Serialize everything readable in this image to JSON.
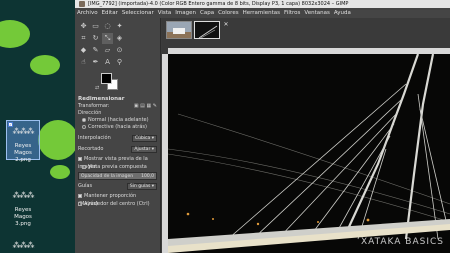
{
  "desktop": {
    "icons": [
      {
        "label": "Reyes Magos\n2.png",
        "selected": true
      },
      {
        "label": "Reyes Magos\n3.png",
        "selected": false
      },
      {
        "label": "",
        "selected": false
      }
    ],
    "thumb_text": "⁂⁂⁂",
    "accent_color": "#7fd93a"
  },
  "window": {
    "title": "[IMG_7792] (importada)-4.0 (Color RGB Entero gamma de 8 bits, Display P3, 1 capa) 8032x3024 – GIMP",
    "menu": [
      "Archivo",
      "Editar",
      "Seleccionar",
      "Vista",
      "Imagen",
      "Capa",
      "Colores",
      "Herramientas",
      "Filtros",
      "Ventanas",
      "Ayuda"
    ]
  },
  "tool_options": {
    "header": "Redimensionar",
    "transform_label": "Transformar:",
    "direction_label": "Dirección",
    "direction_options": [
      "Normal (hacia adelante)",
      "Corrective (hacia atrás)"
    ],
    "interpolation_label": "Interpolación",
    "interpolation_value": "Cúbica",
    "clipping_label": "Recortado",
    "clipping_value": "Ajustar",
    "show_preview_label": "Mostrar vista previa de la imagen",
    "composited_preview_label": "Vista previa compuesta",
    "opacity_label": "Opacidad de la imagen",
    "opacity_value": "100,0",
    "opacity_fraction": 1.0,
    "guides_label": "Guías",
    "guides_value": "Sin guías",
    "keep_aspect_label": "Mantener proporción (Mayús)",
    "around_center_label": "Alrededor del centro (Ctrl)"
  },
  "canvas": {
    "watermark": "XATAKA BASICS"
  },
  "colors": {
    "fg": "#000000",
    "bg": "#ffffff"
  }
}
